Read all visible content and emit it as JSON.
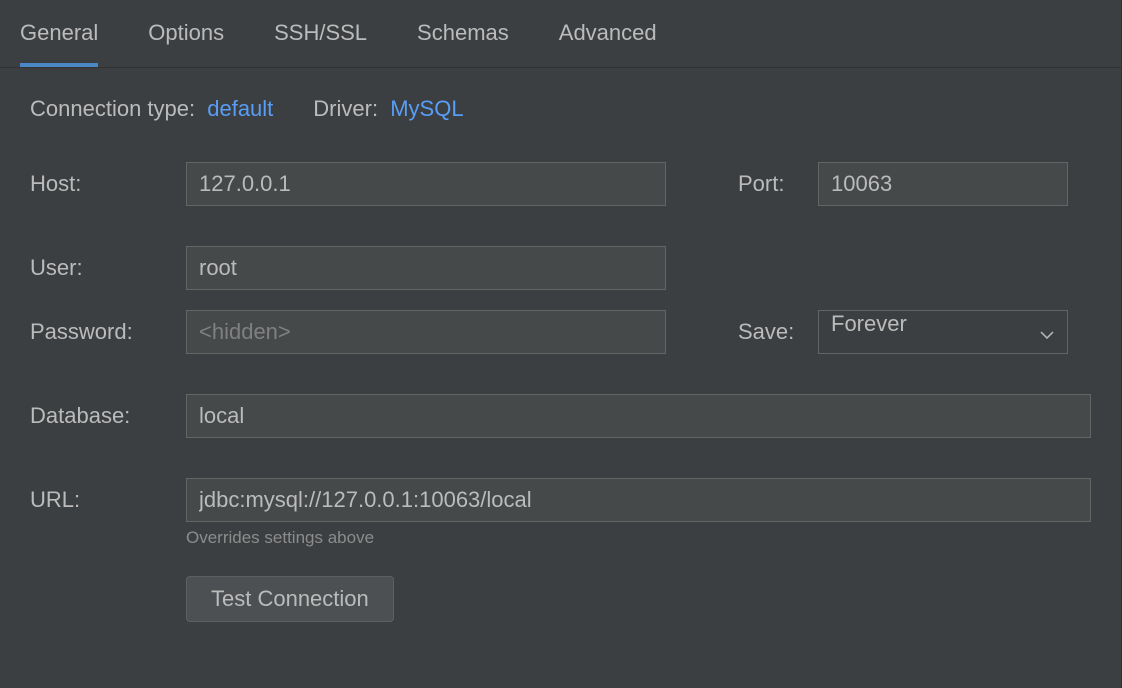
{
  "tabs": {
    "general": "General",
    "options": "Options",
    "sshssl": "SSH/SSL",
    "schemas": "Schemas",
    "advanced": "Advanced"
  },
  "meta": {
    "connection_type_label": "Connection type:",
    "connection_type_value": "default",
    "driver_label": "Driver:",
    "driver_value": "MySQL"
  },
  "form": {
    "host_label": "Host:",
    "host_value": "127.0.0.1",
    "port_label": "Port:",
    "port_value": "10063",
    "user_label": "User:",
    "user_value": "root",
    "password_label": "Password:",
    "password_placeholder": "<hidden>",
    "save_label": "Save:",
    "save_value": "Forever",
    "database_label": "Database:",
    "database_value": "local",
    "url_label": "URL:",
    "url_value": "jdbc:mysql://127.0.0.1:10063/local",
    "url_hint": "Overrides settings above",
    "test_button": "Test Connection"
  }
}
